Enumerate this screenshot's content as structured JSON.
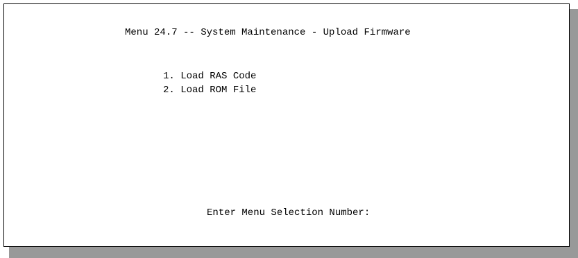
{
  "screen": {
    "title": "Menu 24.7 -- System Maintenance - Upload Firmware",
    "menu_items": [
      {
        "label": "1. Load RAS Code"
      },
      {
        "label": "2. Load ROM File"
      }
    ],
    "prompt": "Enter Menu Selection Number:",
    "selection_value": ""
  }
}
